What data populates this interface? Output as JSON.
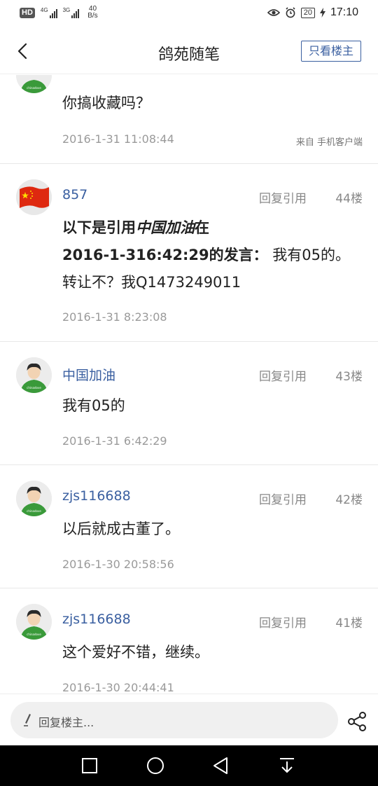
{
  "status_bar": {
    "hd_badge": "HD",
    "signal1_label": "4G",
    "signal2_label": "3G",
    "net_speed_value": "40",
    "net_speed_unit": "B/s",
    "battery": "20",
    "time": "17:10"
  },
  "nav": {
    "title": "鸽苑随笔",
    "only_op_label": "只看楼主"
  },
  "posts": [
    {
      "content": "你搞收藏吗？",
      "timestamp": "2016-1-31 11:08:44",
      "source": "来自 手机客户端"
    },
    {
      "username": "857",
      "reply_quote": "回复引用",
      "floor": "44楼",
      "quote_prefix": "以下是引用",
      "quote_name": "中国加油",
      "quote_mid": "在",
      "quote_time": "2016-1-316:42:29",
      "quote_suffix": "的发言：",
      "content": " 我有05的。转让不？我Q1473249011",
      "timestamp": "2016-1-31 8:23:08"
    },
    {
      "username": "中国加油",
      "reply_quote": "回复引用",
      "floor": "43楼",
      "content": "我有05的",
      "timestamp": "2016-1-31 6:42:29"
    },
    {
      "username": "zjs116688",
      "reply_quote": "回复引用",
      "floor": "42楼",
      "content": "以后就成古董了。",
      "timestamp": "2016-1-30 20:58:56"
    },
    {
      "username": "zjs116688",
      "reply_quote": "回复引用",
      "floor": "41楼",
      "content": "这个爱好不错，继续。",
      "timestamp": "2016-1-30 20:44:41"
    }
  ],
  "reply_bar": {
    "placeholder": "回复楼主..."
  },
  "icons": {
    "back": "chevron-left-icon",
    "share": "share-icon",
    "pen": "pen-icon",
    "eye": "eye-icon",
    "alarm": "alarm-icon",
    "charging": "bolt-icon"
  },
  "colors": {
    "accent": "#3a5fa0",
    "meta_text": "#888888",
    "timestamp": "#9a9a9a",
    "avatar_shirt": "#3a9a3a"
  }
}
